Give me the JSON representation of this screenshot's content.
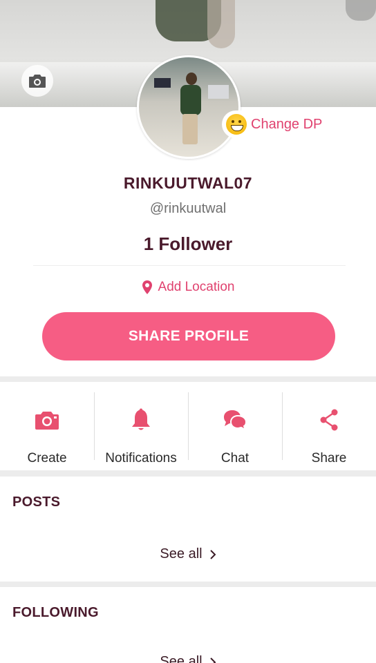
{
  "profile": {
    "username": "RINKUUTWAL07",
    "handle": "@rinkuutwal",
    "followers": "1 Follower",
    "change_dp_label": "Change DP",
    "add_location_label": "Add Location",
    "share_profile_label": "SHARE PROFILE"
  },
  "actions": [
    {
      "label": "Create",
      "icon": "camera-icon"
    },
    {
      "label": "Notifications",
      "icon": "bell-icon"
    },
    {
      "label": "Chat",
      "icon": "chat-bubbles-icon"
    },
    {
      "label": "Share",
      "icon": "share-icon"
    }
  ],
  "sections": {
    "posts": {
      "title": "POSTS",
      "see_all": "See all"
    },
    "following": {
      "title": "FOLLOWING",
      "see_all": "See all"
    }
  },
  "colors": {
    "accent": "#e0426f",
    "button": "#f65d84",
    "heading": "#4a1a2c"
  }
}
